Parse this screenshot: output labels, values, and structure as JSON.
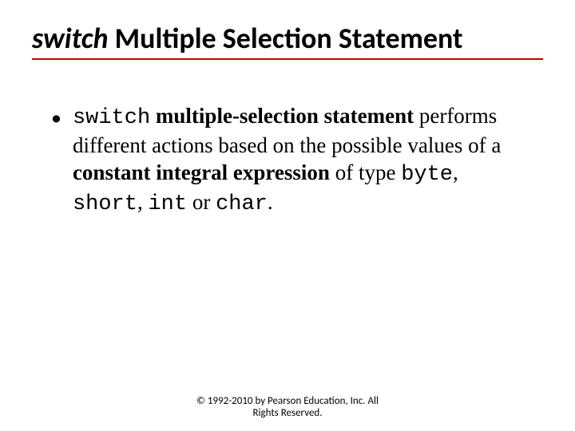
{
  "title": {
    "keyword": "switch",
    "rest": " Multiple Selection Statement"
  },
  "bullet": {
    "kw_switch": "switch",
    "seg_a": " ",
    "bold_a": "multiple-selection statement",
    "seg_b": " performs different actions based on the possible values of a ",
    "bold_b": "constant integral expression",
    "seg_c": " of type ",
    "kw_byte": "byte",
    "comma1": ", ",
    "kw_short": "short",
    "comma2": ", ",
    "kw_int": "int",
    "seg_or": " or ",
    "kw_char": "char",
    "period": "."
  },
  "footer": {
    "line1": "© 1992-2010 by Pearson Education, Inc. All",
    "line2": "Rights Reserved."
  }
}
